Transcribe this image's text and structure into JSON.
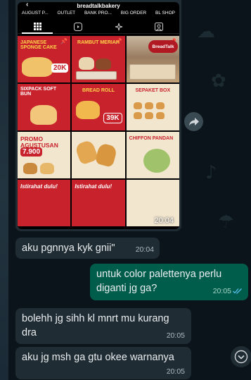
{
  "instagram": {
    "username": "breadtalkbakery",
    "highlights": [
      "AUGUST P...",
      "OUTLET",
      "BANK PRO...",
      "BIG ORDER",
      "BL SHOP"
    ],
    "tiles": [
      {
        "title": "Japanese Sponge Cake",
        "badge": "20K"
      },
      {
        "title": "Rambut Meriah",
        "badge": ""
      },
      {
        "title": "BreadTalk",
        "badge": ""
      },
      {
        "title": "Sixpack Soft Bun",
        "badge": ""
      },
      {
        "title": "Bread Roll",
        "badge": "39K"
      },
      {
        "title": "Sepaket Box",
        "badge": ""
      },
      {
        "title": "Promo Agustusan",
        "badge": "7.900"
      },
      {
        "title": "",
        "badge": ""
      },
      {
        "title": "Chiffon Pandan",
        "badge": ""
      },
      {
        "title": "Istirahat dulu!",
        "badge": ""
      },
      {
        "title": "Istirahat dulu!",
        "badge": ""
      },
      {
        "title": "",
        "badge": ""
      }
    ],
    "image_time": "20:04"
  },
  "messages": [
    {
      "direction": "in",
      "text": "aku pgnnya kyk gnii\"",
      "time": "20:04"
    },
    {
      "direction": "out",
      "text": "untuk color palettenya perlu diganti jg ga?",
      "time": "20:05",
      "ticks": "read"
    },
    {
      "direction": "in",
      "text": "bolehh jg sihh kl mnrt mu kurang dra",
      "time": "20:05"
    },
    {
      "direction": "in",
      "text": "aku jg msh ga gtu okee warnanya",
      "time": "20:05"
    }
  ],
  "colors": {
    "background": "#0b141a",
    "incoming_bubble": "#202c33",
    "outgoing_bubble": "#005c4b",
    "read_ticks": "#53bdeb",
    "brand_red": "#c8222c"
  }
}
